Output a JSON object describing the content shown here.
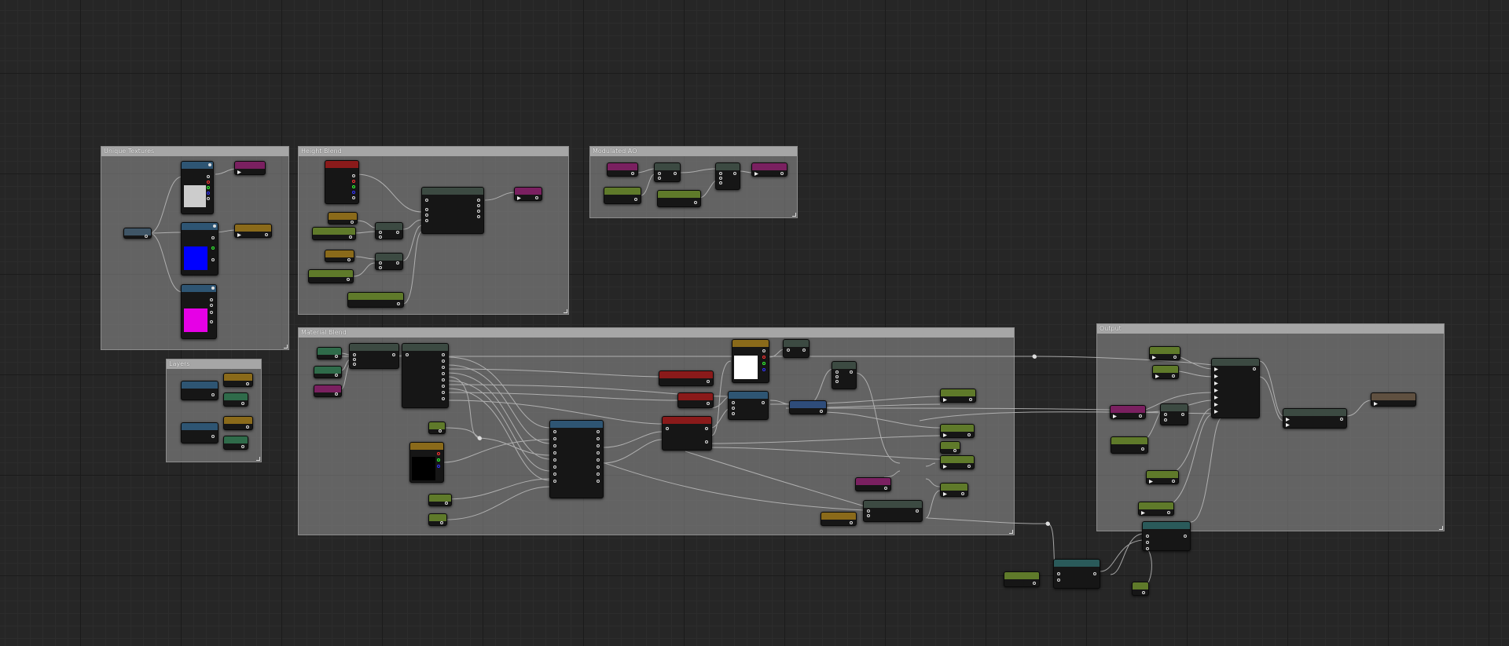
{
  "comments": [
    {
      "id": "unique-textures",
      "title": "Unique Textures"
    },
    {
      "id": "height-blend",
      "title": "Height Blend"
    },
    {
      "id": "modulated-ao",
      "title": "Modulated AO"
    },
    {
      "id": "material-blend",
      "title": "Material Blend"
    },
    {
      "id": "output",
      "title": "Output"
    },
    {
      "id": "layers",
      "title": "Layers"
    }
  ],
  "colors": {
    "background": "#262626",
    "comment_bg": "#969696",
    "header_texture": "#2e5573",
    "header_param_scalar": "#5f7a2a",
    "header_param_vector": "#8a6a1a",
    "header_param_texture": "#7a2060",
    "header_function": "#3c4a42",
    "header_red": "#8a1a1a",
    "swatch_white": "#cccccc",
    "swatch_blue": "#0000ff",
    "swatch_magenta": "#e600e6",
    "swatch_black": "#000000"
  }
}
